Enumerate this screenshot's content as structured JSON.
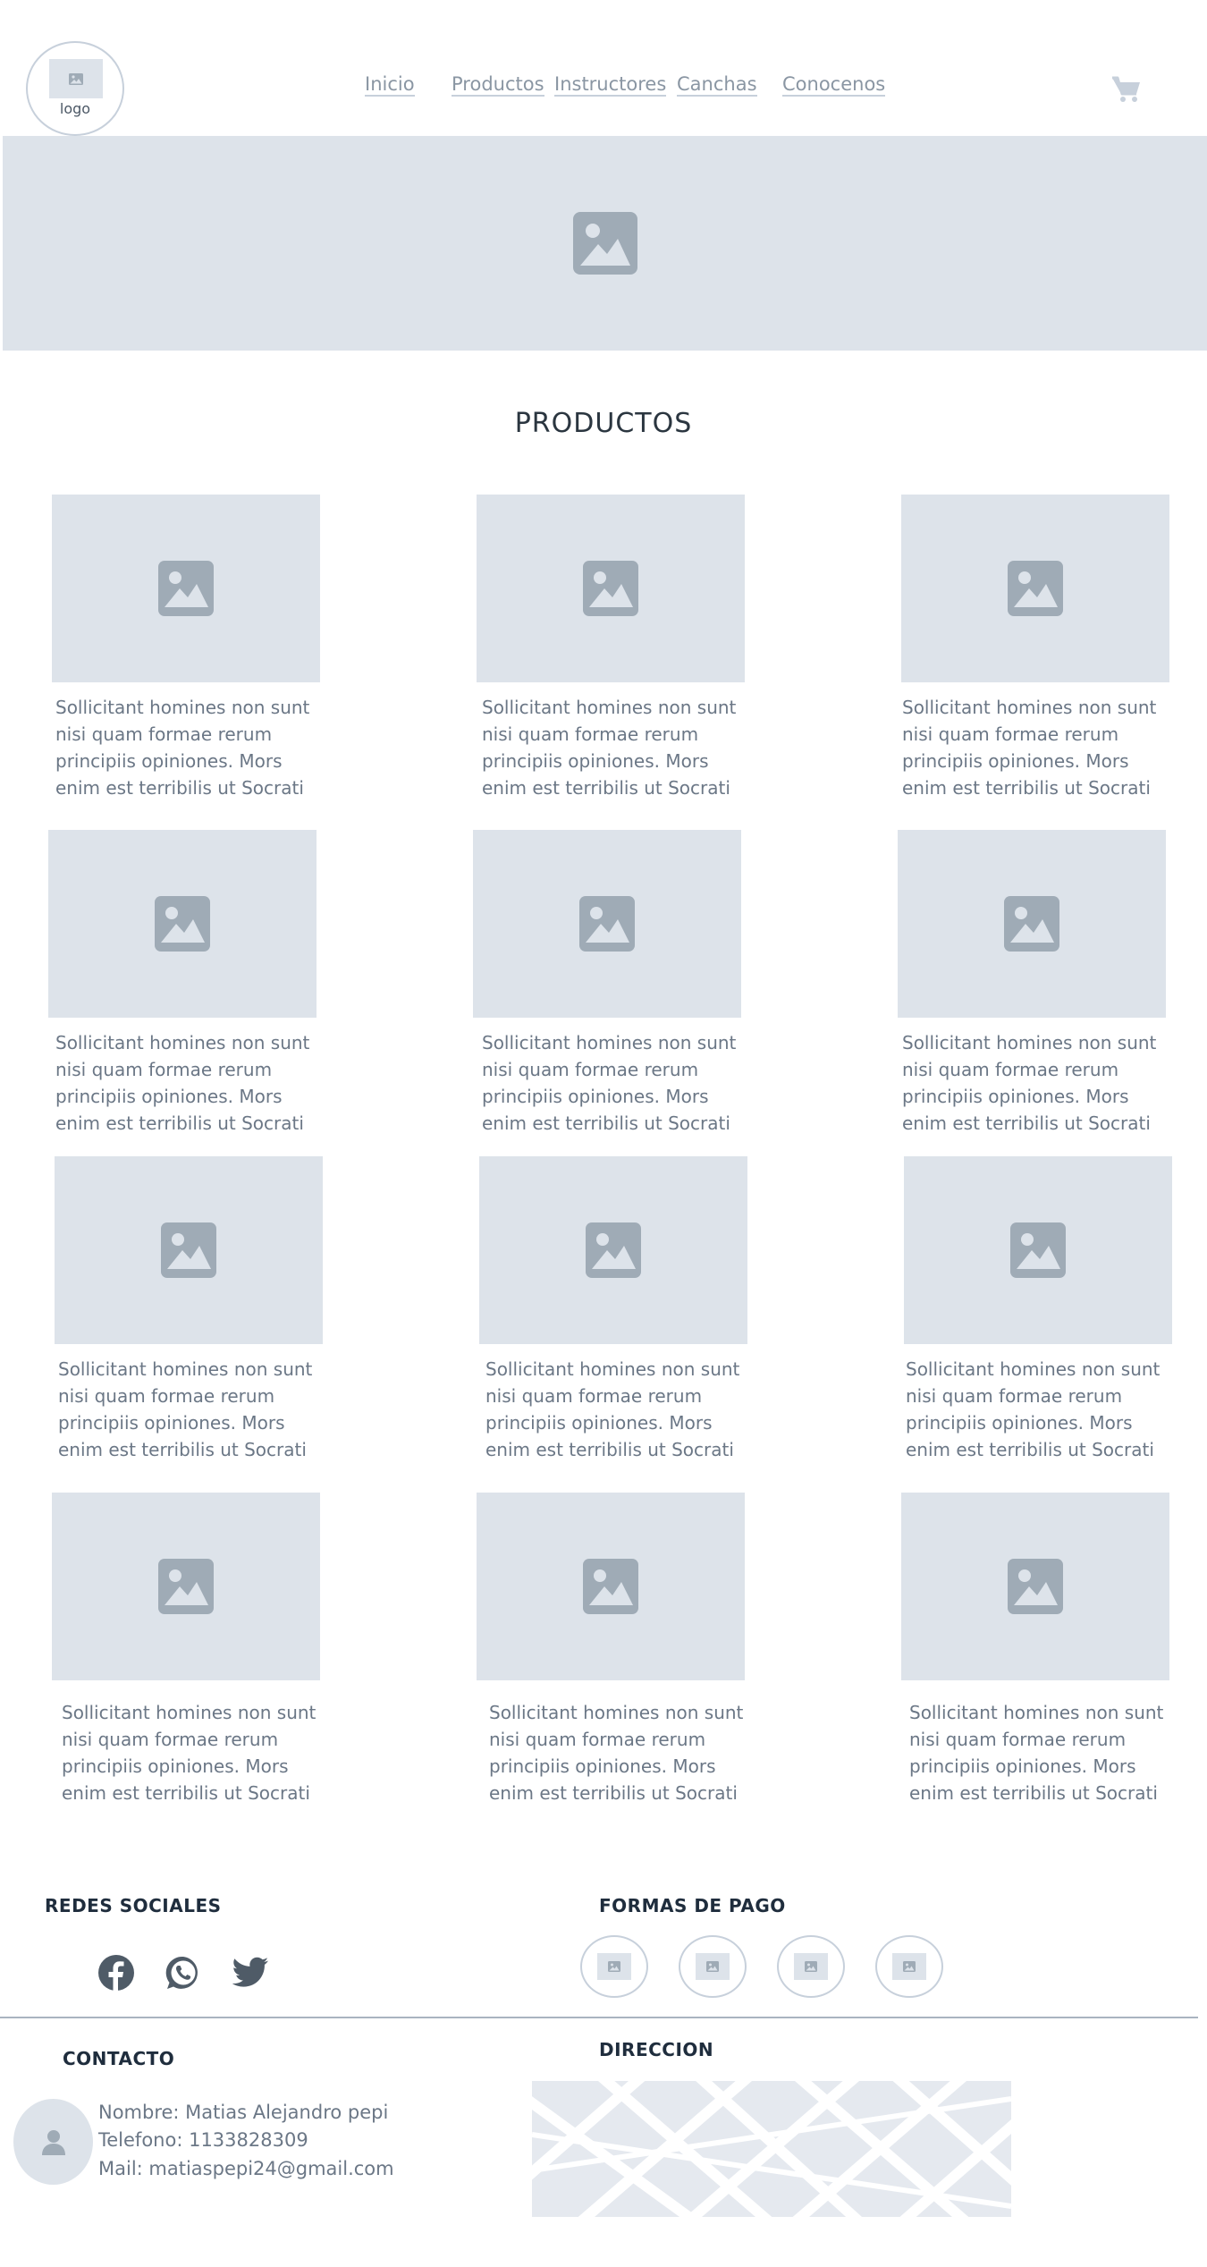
{
  "header": {
    "logo_label": "logo",
    "nav": [
      {
        "label": "Inicio"
      },
      {
        "label": "Productos"
      },
      {
        "label": "Instructores"
      },
      {
        "label": "Canchas"
      },
      {
        "label": "Conocenos"
      }
    ],
    "cart_icon": "shopping-cart-icon"
  },
  "hero": {
    "icon": "image-placeholder-icon"
  },
  "products": {
    "title": "PRODUCTOS",
    "items": [
      {
        "text": "Sollicitant homines non sunt nisi quam formae rerum principiis opiniones. Mors enim est terribilis ut Socrati"
      },
      {
        "text": "Sollicitant homines non sunt nisi quam formae rerum principiis opiniones. Mors enim est terribilis ut Socrati"
      },
      {
        "text": "Sollicitant homines non sunt nisi quam formae rerum principiis opiniones. Mors enim est terribilis ut Socrati"
      },
      {
        "text": "Sollicitant homines non sunt nisi quam formae rerum principiis opiniones. Mors enim est terribilis ut Socrati"
      },
      {
        "text": "Sollicitant homines non sunt nisi quam formae rerum principiis opiniones. Mors enim est terribilis ut Socrati"
      },
      {
        "text": "Sollicitant homines non sunt nisi quam formae rerum principiis opiniones. Mors enim est terribilis ut Socrati"
      },
      {
        "text": "Sollicitant homines non sunt nisi quam formae rerum principiis opiniones. Mors enim est terribilis ut Socrati"
      },
      {
        "text": "Sollicitant homines non sunt nisi quam formae rerum principiis opiniones. Mors enim est terribilis ut Socrati"
      },
      {
        "text": "Sollicitant homines non sunt nisi quam formae rerum principiis opiniones. Mors enim est terribilis ut Socrati"
      },
      {
        "text": "Sollicitant homines non sunt nisi quam formae rerum principiis opiniones. Mors enim est terribilis ut Socrati"
      },
      {
        "text": "Sollicitant homines non sunt nisi quam formae rerum principiis opiniones. Mors enim est terribilis ut Socrati"
      },
      {
        "text": "Sollicitant homines non sunt nisi quam formae rerum principiis opiniones. Mors enim est terribilis ut Socrati"
      }
    ]
  },
  "footer": {
    "social_title": "REDES SOCIALES",
    "social_icons": [
      "facebook-icon",
      "whatsapp-icon",
      "twitter-icon"
    ],
    "payment_title": "FORMAS DE PAGO",
    "contact_title": "CONTACTO",
    "contact": {
      "name": "Nombre: Matias Alejandro pepi",
      "phone": "Telefono: 1133828309",
      "mail": "Mail: matiaspepi24@gmail.com"
    },
    "address_title": "DIRECCION"
  },
  "colors": {
    "placeholder": "#dde3ea",
    "placeholder_icon": "#9fabb6",
    "nav_text": "#8a96a3",
    "body_text": "#6b7786",
    "heading": "#1f2d3d",
    "social_icon": "#4f5b67"
  }
}
